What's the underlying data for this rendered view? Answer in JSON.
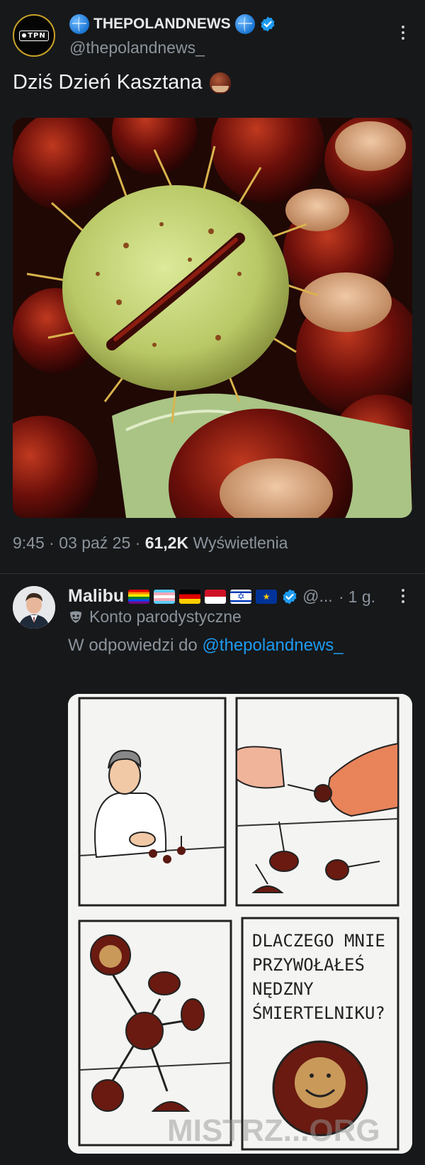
{
  "post1": {
    "display_name": "THEPOLANDNEWS",
    "handle": "@thepolandnews_",
    "avatar_text": "TPN",
    "text": "Dziś Dzień Kasztana",
    "time": "9:45",
    "date": "03 paź 25",
    "views_count": "61,2K",
    "views_label": "Wyświetlenia",
    "image_icon": "chestnut-emoji"
  },
  "post2": {
    "display_name": "Malibu",
    "handle": "@...",
    "time_ago": "1 g.",
    "parody_label": "Konto parodystyczne",
    "reply_prefix": "W odpowiedzi do",
    "reply_handle": "@thepolandnews_",
    "flags": [
      "rainbow",
      "transgender",
      "germany",
      "monaco",
      "israel",
      "eu"
    ],
    "comic_caption": [
      "DLACZEGO MNIE",
      "PRZYWOŁAŁEŚ",
      "NĘDZNY",
      "ŚMIERTELNIKU?"
    ],
    "watermark": "MISTRZ...ORG"
  },
  "colors": {
    "background": "#17181a",
    "link": "#1d9bf0",
    "verified": "#1d9bf0",
    "muted": "#8b949c"
  }
}
